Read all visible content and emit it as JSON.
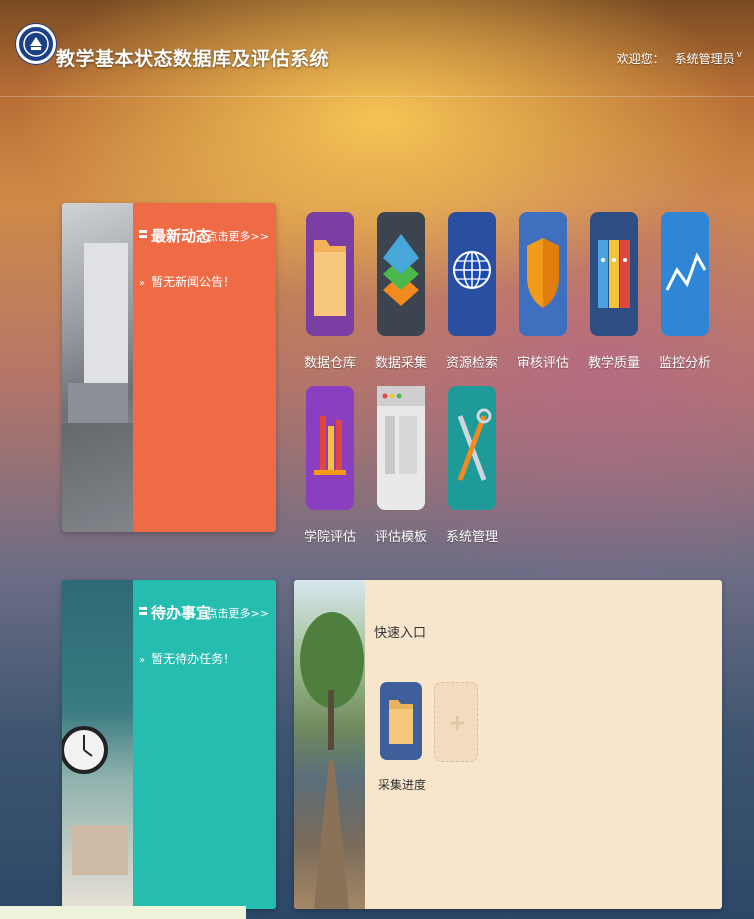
{
  "header": {
    "title": "教学基本状态数据库及评估系统",
    "welcome_label": "欢迎您：",
    "username": "系统管理员",
    "caret": "v"
  },
  "news": {
    "title": "最新动态",
    "more": "点击更多>>",
    "item": "暂无新闻公告！"
  },
  "todo": {
    "title": "待办事宜",
    "more": "点击更多>>",
    "item": "暂无待办任务！"
  },
  "apps": [
    {
      "label": "数据仓库",
      "icon": "folder-icon",
      "color": "#7b3fa3"
    },
    {
      "label": "数据采集",
      "icon": "layers-icon",
      "color": "#3c4450"
    },
    {
      "label": "资源检索",
      "icon": "globe-icon",
      "color": "#2a4fa0"
    },
    {
      "label": "审核评估",
      "icon": "shield-icon",
      "color": "#3f6fbf"
    },
    {
      "label": "教学质量",
      "icon": "binders-icon",
      "color": "#2d4e82"
    },
    {
      "label": "监控分析",
      "icon": "line-chart-icon",
      "color": "#2f86d6"
    },
    {
      "label": "学院评估",
      "icon": "books-icon",
      "color": "#8a3fc0"
    },
    {
      "label": "评估模板",
      "icon": "browser-window-icon",
      "color": "#e9e9e9"
    },
    {
      "label": "系统管理",
      "icon": "tools-icon",
      "color": "#1e9b98"
    }
  ],
  "quick": {
    "title": "快速入口",
    "items": [
      {
        "label": "采集进度",
        "icon": "folder-icon"
      }
    ],
    "add": "+"
  }
}
